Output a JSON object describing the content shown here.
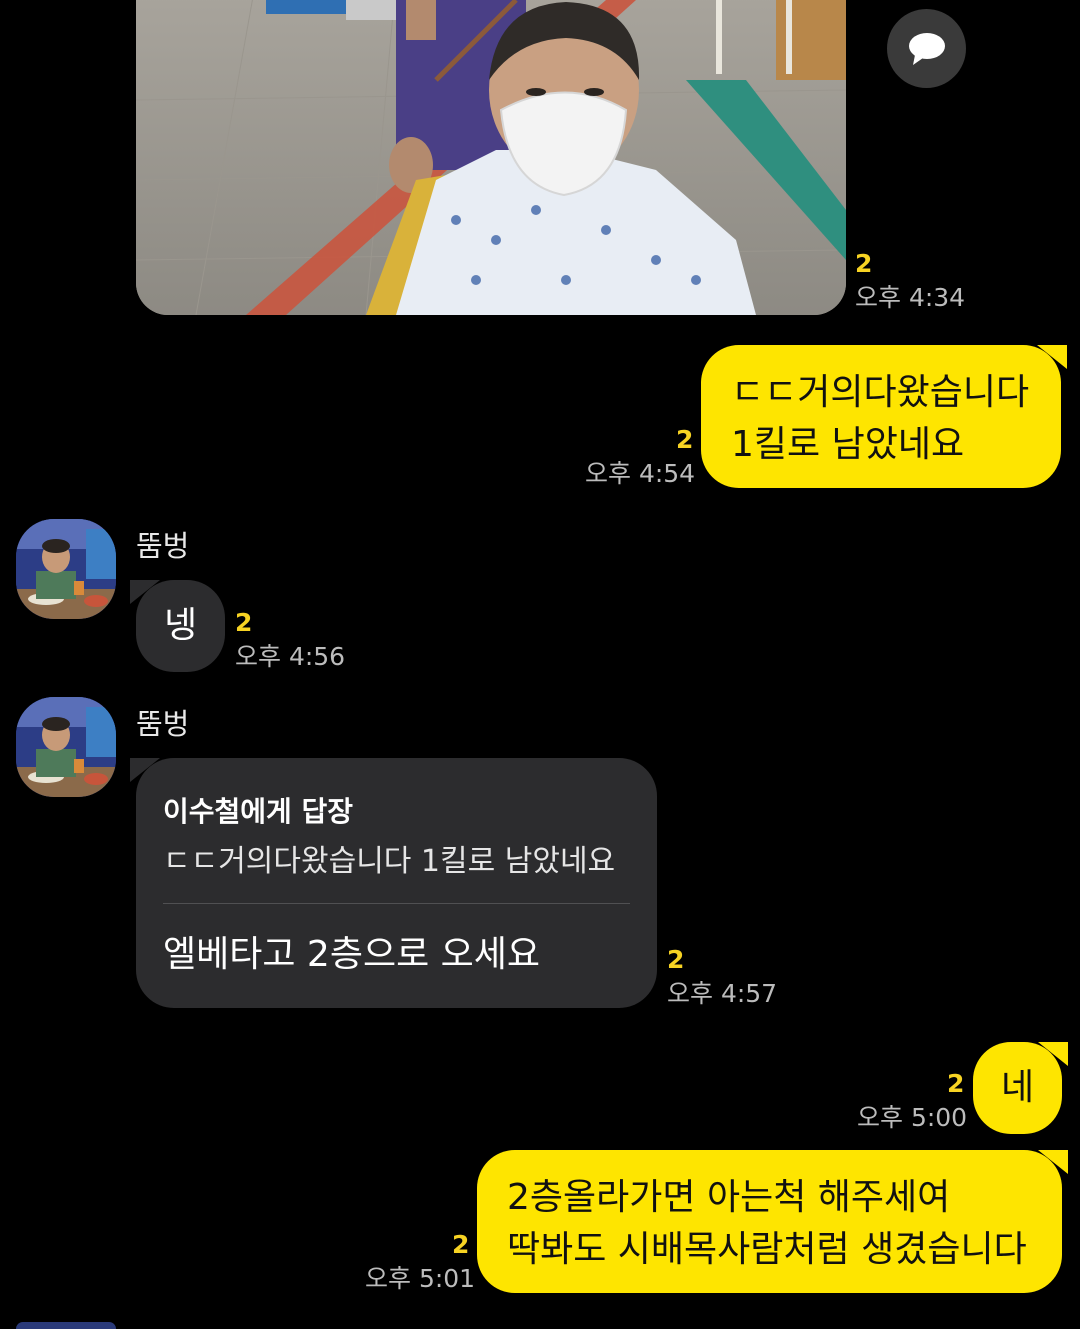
{
  "colors": {
    "background": "#000000",
    "my_bubble": "#fee500",
    "other_bubble": "#2c2c2e",
    "unread_count": "#f7d323",
    "timestamp": "#bcbcbc"
  },
  "photo_message": {
    "unread": "2",
    "time": "오후 4:34",
    "share_icon": "speech-bubble-icon"
  },
  "messages": [
    {
      "from": "me",
      "lines": [
        "ㄷㄷ거의다왔습니다",
        "1킬로 남았네요"
      ],
      "unread": "2",
      "time": "오후 4:54"
    },
    {
      "from": "other",
      "sender": "뚬벙",
      "lines": [
        "넹"
      ],
      "unread": "2",
      "time": "오후 4:56"
    },
    {
      "from": "other",
      "sender": "뚬벙",
      "reply_to_name": "이수철에게 답장",
      "reply_to_text": "ㄷㄷ거의다왔습니다 1킬로 남았네요",
      "lines": [
        "엘베타고 2층으로 오세요"
      ],
      "unread": "2",
      "time": "오후 4:57"
    },
    {
      "from": "me",
      "lines": [
        "네"
      ],
      "unread": "2",
      "time": "오후 5:00"
    },
    {
      "from": "me",
      "lines": [
        "2층올라가면 아는척 해주세여",
        "딱봐도 시배목사람처럼 생겼습니다"
      ],
      "unread": "2",
      "time": "오후 5:01"
    }
  ]
}
